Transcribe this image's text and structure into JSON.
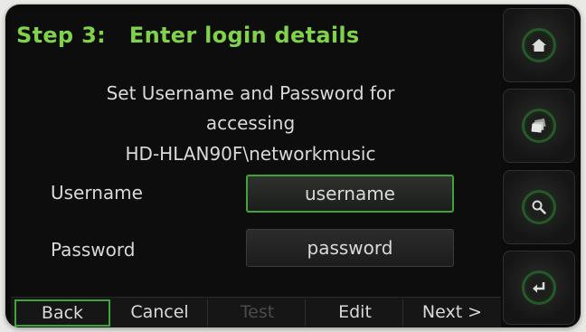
{
  "title": "Step 3:   Enter login details",
  "message": {
    "line1": "Set Username and Password for",
    "line2": "accessing",
    "line3": "HD-HLAN90F\\networkmusic"
  },
  "form": {
    "username_label": "Username",
    "username_value": "username",
    "password_label": "Password",
    "password_value": "password"
  },
  "softkeys": {
    "back": "Back",
    "cancel": "Cancel",
    "test": "Test",
    "edit": "Edit",
    "next": "Next >"
  },
  "side_buttons": [
    "home-icon",
    "browse-icon",
    "search-icon",
    "enter-icon"
  ],
  "colors": {
    "accent": "#7fd24a",
    "active_border": "#3fa53a",
    "text": "#d9d9d9",
    "disabled": "#4a4b4a"
  }
}
